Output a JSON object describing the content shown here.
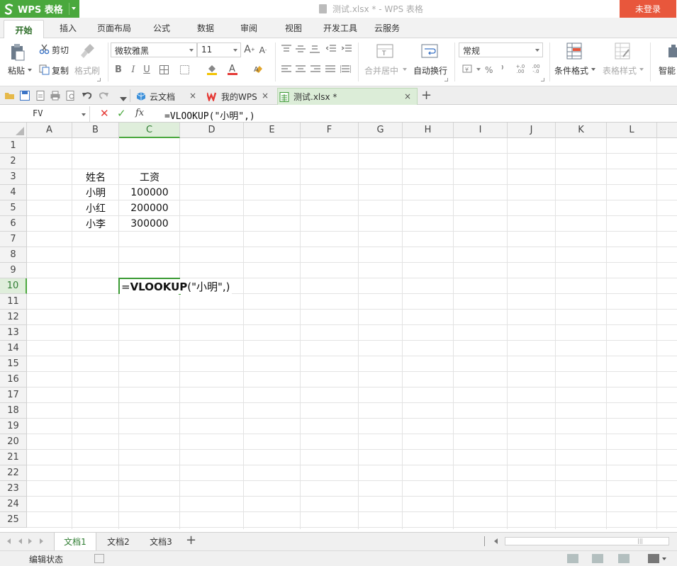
{
  "app": {
    "name": "WPS 表格",
    "window_title": "测试.xlsx * - WPS 表格",
    "login_label": "未登录"
  },
  "ribbon_tabs": [
    "开始",
    "插入",
    "页面布局",
    "公式",
    "数据",
    "审阅",
    "视图",
    "开发工具",
    "云服务"
  ],
  "active_ribbon_tab": "开始",
  "ribbon": {
    "paste": "粘贴",
    "cut": "剪切",
    "copy": "复制",
    "format_painter": "格式刷",
    "font_name": "微软雅黑",
    "font_size": "11",
    "merge_center": "合并居中",
    "wrap_text": "自动换行",
    "number_format": "常规",
    "percent": "%",
    "comma": "⁾",
    "conditional_format": "条件格式",
    "table_style": "表格样式",
    "smart": "智能"
  },
  "doc_tabs": [
    {
      "label": "云文档",
      "icon": "cloud-doc-icon"
    },
    {
      "label": "我的WPS",
      "icon": "wps-logo-icon"
    },
    {
      "label": "测试.xlsx *",
      "icon": "spreadsheet-file-icon"
    }
  ],
  "formula_bar": {
    "name_box": "FV",
    "fx": "fx",
    "formula": "=VLOOKUP(\"小明\",)"
  },
  "columns": [
    "A",
    "B",
    "C",
    "D",
    "E",
    "F",
    "G",
    "H",
    "I",
    "J",
    "K",
    "L"
  ],
  "selected_column": "C",
  "rows": [
    "1",
    "2",
    "3",
    "4",
    "5",
    "6",
    "7",
    "8",
    "9",
    "10",
    "11",
    "12",
    "13",
    "14",
    "15",
    "16",
    "17",
    "18",
    "19",
    "20",
    "21",
    "22",
    "23",
    "24",
    "25"
  ],
  "selected_row": "10",
  "cells": {
    "B3": "姓名",
    "C3": "工资",
    "B4": "小明",
    "C4": "100000",
    "B5": "小红",
    "C5": "200000",
    "B6": "小李",
    "C6": "300000"
  },
  "active_cell_edit": {
    "prefix": "=",
    "func": "VLOOKUP",
    "args": "(\"小明\",)"
  },
  "sheets": [
    "文档1",
    "文档2",
    "文档3"
  ],
  "active_sheet": "文档1",
  "add_sheet": "+",
  "status_text": "编辑状态",
  "colors": {
    "green": "#4aa83d",
    "login_red": "#e8573c"
  }
}
